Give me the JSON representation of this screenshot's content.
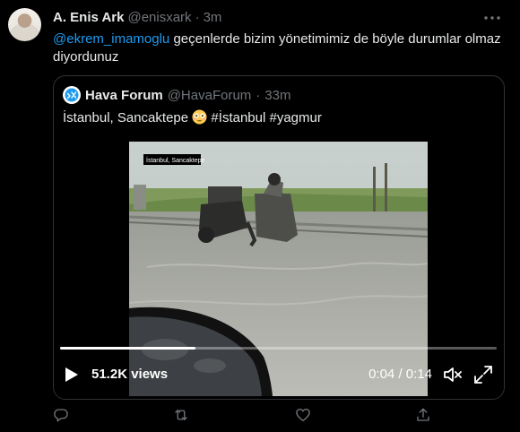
{
  "tweet": {
    "author_name": "A. Enis Ark",
    "author_handle": "@enisxark",
    "dot": "·",
    "time": "3m",
    "mention": "@ekrem_imamoglu",
    "text": " geçenlerde bizim yönetimimiz de böyle durumlar olmaz diyordunuz"
  },
  "quote": {
    "author_name": "Hava Forum",
    "author_handle": "@HavaForum",
    "dot": "·",
    "time": "33m",
    "text_before_emoji": "İstanbul, Sancaktepe ",
    "text_after_emoji": "  #İstanbul #yagmur",
    "emoji": "flushed-face",
    "video": {
      "overlay_label": "İstanbul, Sancaktepe",
      "views": "51.2K views",
      "time_current": "0:04",
      "time_separator": " / ",
      "time_total": "0:14",
      "progress": 0.31
    }
  },
  "actions": [
    "reply",
    "retweet",
    "like",
    "share"
  ],
  "colors": {
    "background": "#000000",
    "text": "#e7e9ea",
    "secondary": "#71767b",
    "link": "#1d9bf0",
    "border": "#2f3336"
  }
}
